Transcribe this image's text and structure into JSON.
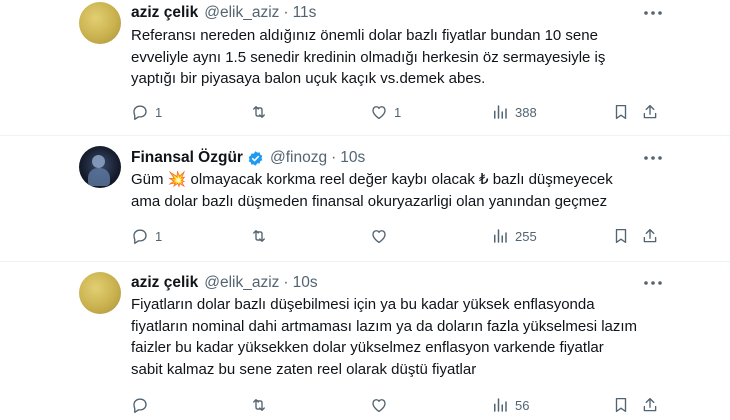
{
  "tweets": [
    {
      "name": "aziz çelik",
      "handle": "@elik_aziz",
      "separator": "·",
      "time": "11s",
      "verified": false,
      "avatar_color": "#c9b14e",
      "lines": [
        "Referansı nereden aldığınız önemli dolar bazlı fiyatlar bundan 10 sene",
        "evveliyle aynı 1.5 senedir kredinin olmadığı herkesin öz sermayesiyle iş",
        "yaptığı bir piyasaya balon uçuk kaçık vs.demek abes."
      ],
      "replies": "1",
      "retweets": "",
      "likes": "1",
      "views": "388"
    },
    {
      "name": "Finansal Özgür",
      "handle": "@finozg",
      "separator": "·",
      "time": "10s",
      "verified": true,
      "avatar_color": "#151c2c",
      "line1_a": "Güm ",
      "line1_emoji": "💥",
      "line1_b": " olmayacak korkma reel değer kaybı olacak ₺ bazlı düşmeyecek",
      "line2": "ama dolar bazlı düşmeden finansal okuryazarligi olan yanından geçmez",
      "replies": "1",
      "retweets": "",
      "likes": "",
      "views": "255"
    },
    {
      "name": "aziz çelik",
      "handle": "@elik_aziz",
      "separator": "·",
      "time": "10s",
      "verified": false,
      "avatar_color": "#c9b14e",
      "lines": [
        "Fiyatların dolar bazlı düşebilmesi için ya bu kadar yüksek enflasyonda",
        "fiyatların nominal dahi artmaması lazım ya da doların fazla yükselmesi lazım",
        "faizler bu kadar yüksekken dolar yükselmez enflasyon varkende fiyatlar",
        "sabit kalmaz bu sene zaten reel olarak düştü fiyatlar"
      ],
      "replies": "",
      "retweets": "",
      "likes": "",
      "views": "56"
    }
  ],
  "icons": {
    "more": "more-icon",
    "reply": "reply-icon",
    "retweet": "retweet-icon",
    "like": "like-icon",
    "views": "views-icon",
    "bookmark": "bookmark-icon",
    "share": "share-icon",
    "verified": "verified-badge-icon"
  },
  "colors": {
    "text": "#0f1419",
    "secondary": "#536471",
    "verified": "#1d9bf0",
    "divider": "#eff3f4"
  }
}
